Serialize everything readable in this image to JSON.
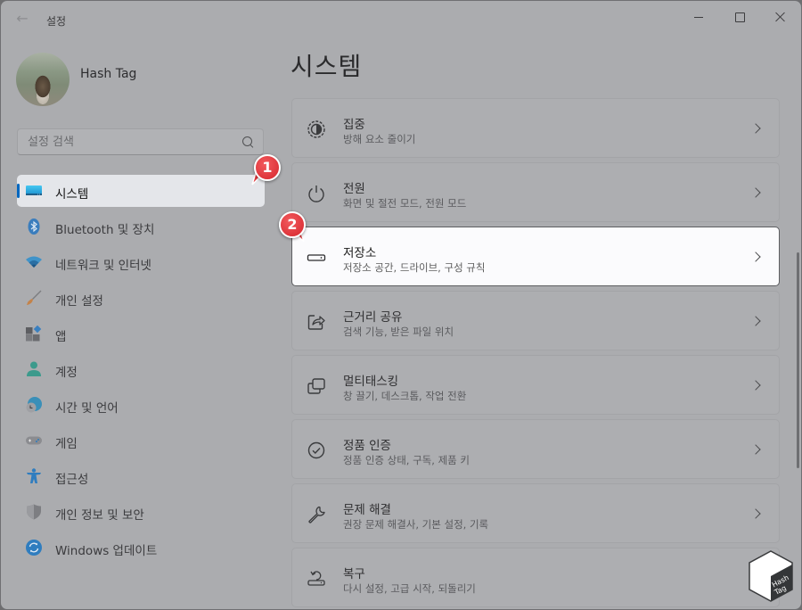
{
  "window": {
    "title": "설정",
    "controls": {
      "minimize": "minimize-icon",
      "maximize": "maximize-icon",
      "close": "close-icon"
    }
  },
  "profile": {
    "name": "Hash Tag"
  },
  "search": {
    "placeholder": "설정 검색",
    "value": ""
  },
  "sidebar": {
    "items": [
      {
        "label": "시스템",
        "icon": "system-display-icon",
        "active": true
      },
      {
        "label": "Bluetooth 및 장치",
        "icon": "bluetooth-icon",
        "active": false
      },
      {
        "label": "네트워크 및 인터넷",
        "icon": "wifi-icon",
        "active": false
      },
      {
        "label": "개인 설정",
        "icon": "paintbrush-icon",
        "active": false
      },
      {
        "label": "앱",
        "icon": "apps-icon",
        "active": false
      },
      {
        "label": "계정",
        "icon": "account-icon",
        "active": false
      },
      {
        "label": "시간 및 언어",
        "icon": "time-language-icon",
        "active": false
      },
      {
        "label": "게임",
        "icon": "gamepad-icon",
        "active": false
      },
      {
        "label": "접근성",
        "icon": "accessibility-icon",
        "active": false
      },
      {
        "label": "개인 정보 및 보안",
        "icon": "shield-icon",
        "active": false
      },
      {
        "label": "Windows 업데이트",
        "icon": "windows-update-icon",
        "active": false
      }
    ]
  },
  "main": {
    "title": "시스템",
    "cards": [
      {
        "title": "집중",
        "subtitle": "방해 요소 줄이기",
        "icon": "focus-icon",
        "active": false
      },
      {
        "title": "전원",
        "subtitle": "화면 및 절전 모드, 전원 모드",
        "icon": "power-icon",
        "active": false
      },
      {
        "title": "저장소",
        "subtitle": "저장소 공간, 드라이브, 구성 규칙",
        "icon": "storage-drive-icon",
        "active": true
      },
      {
        "title": "근거리 공유",
        "subtitle": "검색 기능, 받은 파일 위치",
        "icon": "nearby-share-icon",
        "active": false
      },
      {
        "title": "멀티태스킹",
        "subtitle": "창 끌기, 데스크톱, 작업 전환",
        "icon": "multitasking-icon",
        "active": false
      },
      {
        "title": "정품 인증",
        "subtitle": "정품 인증 상태, 구독, 제품 키",
        "icon": "activation-check-icon",
        "active": false
      },
      {
        "title": "문제 해결",
        "subtitle": "권장 문제 해결사, 기본 설정, 기록",
        "icon": "wrench-icon",
        "active": false
      },
      {
        "title": "복구",
        "subtitle": "다시 설정, 고급 시작, 되돌리기",
        "icon": "recovery-icon",
        "active": false
      }
    ]
  },
  "annotations": {
    "callout_1": "1",
    "callout_2": "2",
    "callout_color": "#e0353a"
  },
  "watermark": {
    "line1": "Hash",
    "line2": "Tag"
  },
  "colors": {
    "accent": "#0067c0",
    "overlay_bg": "#abacaf",
    "highlight_bg": "#fbfbfd"
  }
}
